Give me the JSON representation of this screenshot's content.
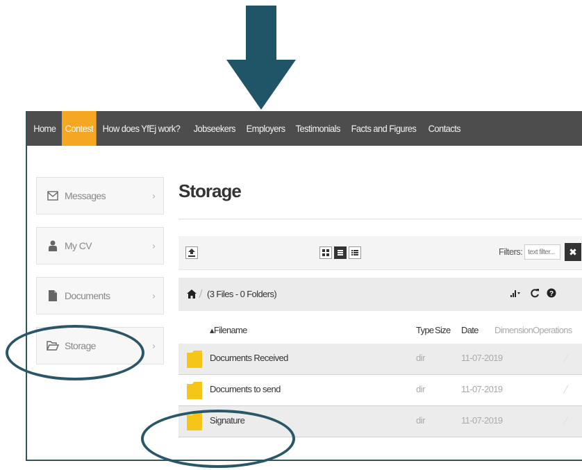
{
  "nav": {
    "items": [
      {
        "label": "Home",
        "active": false
      },
      {
        "label": "Contest",
        "active": true
      },
      {
        "label": "How does YfEj work?",
        "active": false
      },
      {
        "label": "Jobseekers",
        "active": false
      },
      {
        "label": "Employers",
        "active": false
      },
      {
        "label": "Testimonials",
        "active": false
      },
      {
        "label": "Facts and Figures",
        "active": false
      },
      {
        "label": "Contacts",
        "active": false
      }
    ]
  },
  "sidebar": {
    "items": [
      {
        "label": "Messages",
        "icon": "envelope-icon"
      },
      {
        "label": "My CV",
        "icon": "user-icon"
      },
      {
        "label": "Documents",
        "icon": "file-icon"
      },
      {
        "label": "Storage",
        "icon": "folder-open-icon"
      }
    ],
    "chevron": "›"
  },
  "page": {
    "title": "Storage"
  },
  "toolbar": {
    "filters_label": "Filters:",
    "filter_placeholder": "text filter...",
    "clear_symbol": "✖"
  },
  "path": {
    "summary": "(3 Files - 0 Folders)"
  },
  "table": {
    "headers": {
      "filename": "▴Filename",
      "type": "Type",
      "size": "Size",
      "date": "Date",
      "dimension": "Dimension",
      "operations": "Operations"
    },
    "rows": [
      {
        "name": "Documents Received",
        "type": "dir",
        "date": "11-07-2019"
      },
      {
        "name": "Documents to send",
        "type": "dir",
        "date": "11-07-2019"
      },
      {
        "name": "Signature",
        "type": "dir",
        "date": "11-07-2019"
      }
    ]
  },
  "colors": {
    "nav_bg": "#4d4d4d",
    "nav_active": "#f5a623",
    "annotation": "#2a5767",
    "folder": "#f5c518"
  }
}
